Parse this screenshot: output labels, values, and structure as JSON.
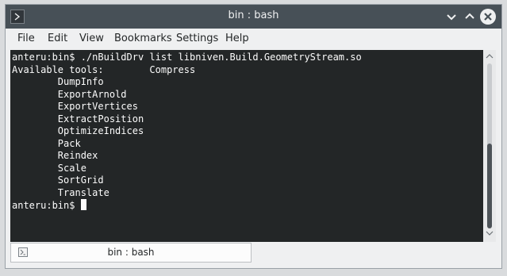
{
  "window": {
    "title": "bin : bash",
    "controls": {
      "minimize_icon": "chevron-down-icon",
      "maximize_icon": "chevron-up-icon",
      "close_icon": "close-icon"
    }
  },
  "menu": {
    "items": [
      "File",
      "Edit",
      "View",
      "Bookmarks",
      "Settings",
      "Help"
    ]
  },
  "terminal": {
    "lines": [
      "anteru:bin$ ./nBuildDrv list libniven.Build.GeometryStream.so",
      "Available tools:        Compress",
      "        DumpInfo",
      "        ExportArnold",
      "        ExportVertices",
      "        ExtractPosition",
      "        OptimizeIndices",
      "        Pack",
      "        Reindex",
      "        Scale",
      "        SortGrid",
      "        Translate"
    ],
    "prompt": "anteru:bin$ "
  },
  "tabs": [
    {
      "label": "bin : bash",
      "icon": "terminal-icon"
    }
  ],
  "colors": {
    "titlebar": "#475057",
    "terminal_bg": "#232627",
    "terminal_fg": "#fcfcfc",
    "chrome_bg": "#eff0f1"
  }
}
